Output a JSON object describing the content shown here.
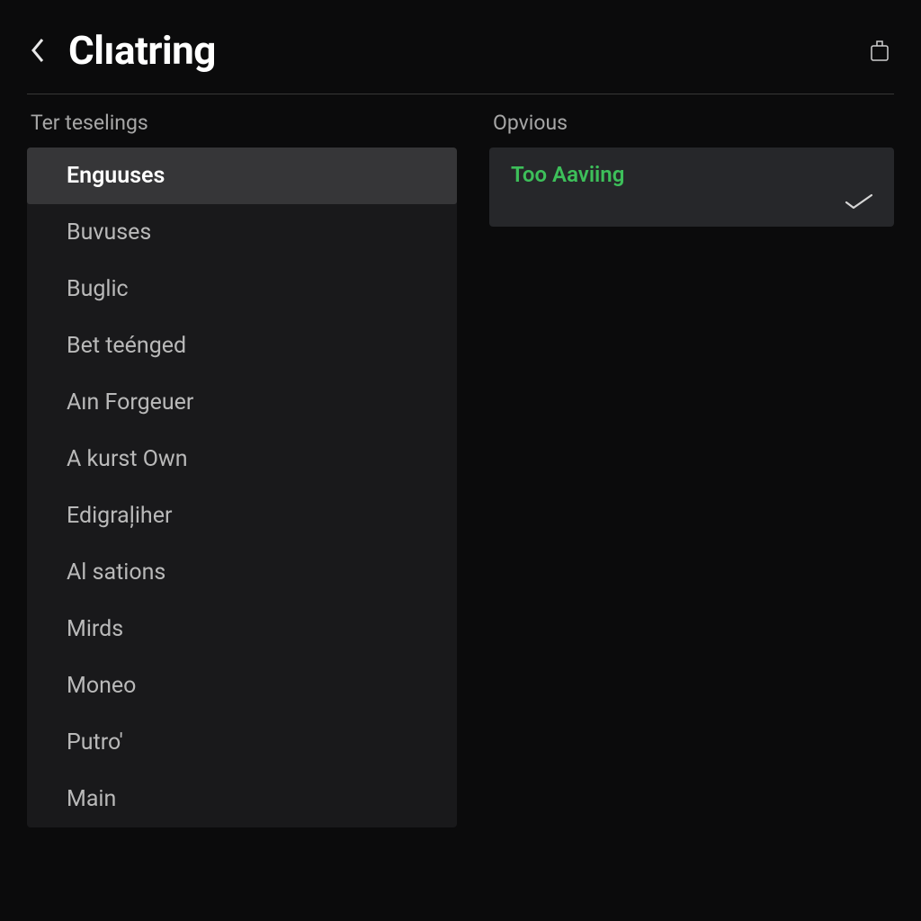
{
  "header": {
    "title": "Clıatring"
  },
  "left": {
    "section_label": "Ter teselings",
    "items": [
      {
        "label": "Enguuses",
        "selected": true
      },
      {
        "label": "Buvuses",
        "selected": false
      },
      {
        "label": "Buglic",
        "selected": false
      },
      {
        "label": "Bet teénged",
        "selected": false
      },
      {
        "label": "Aın Forgeuer",
        "selected": false
      },
      {
        "label": "A kurst Own",
        "selected": false
      },
      {
        "label": "Edigraļiher",
        "selected": false
      },
      {
        "label": "Al sations",
        "selected": false
      },
      {
        "label": "Mirds",
        "selected": false
      },
      {
        "label": "Moneo",
        "selected": false
      },
      {
        "label": "Putro'",
        "selected": false
      },
      {
        "label": "Main",
        "selected": false
      }
    ]
  },
  "right": {
    "section_label": "Opvious",
    "card_title": "Too Aaviing"
  },
  "colors": {
    "accent_green": "#3dbf5a"
  }
}
